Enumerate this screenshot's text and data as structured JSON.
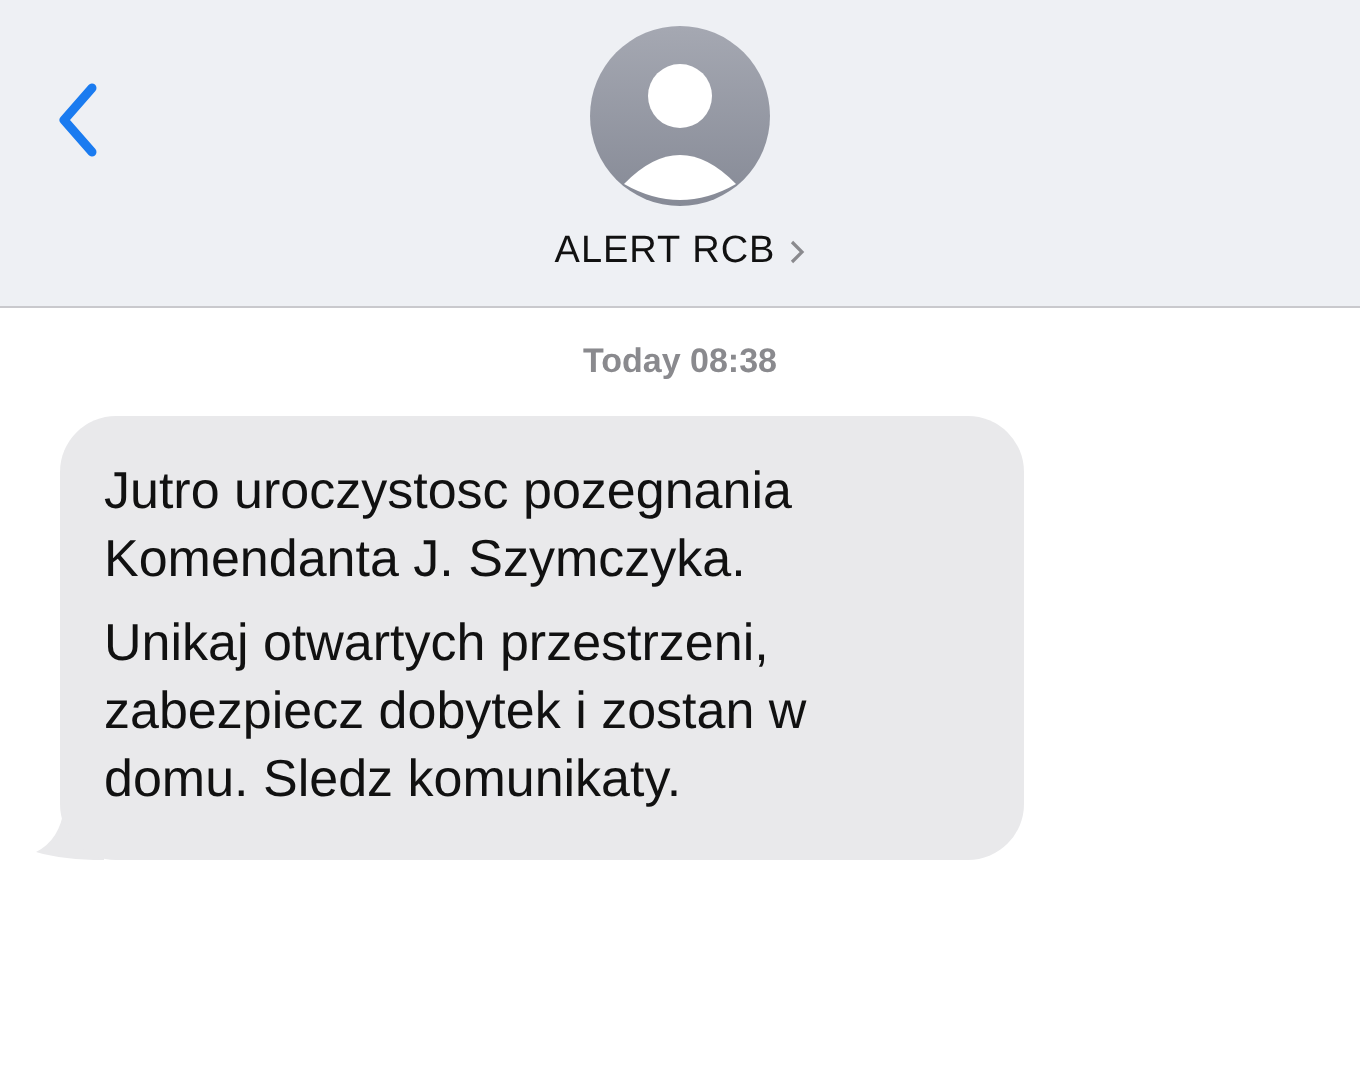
{
  "header": {
    "contact_name": "ALERT RCB"
  },
  "timestamp": "Today 08:38",
  "message": {
    "paragraphs": [
      "Jutro uroczystosc pozegnania\nKomendanta J. Szymczyka.",
      "Unikaj otwartych przestrzeni,\nzabezpiecz dobytek i zostan w\ndomu. Sledz komunikaty."
    ]
  }
}
